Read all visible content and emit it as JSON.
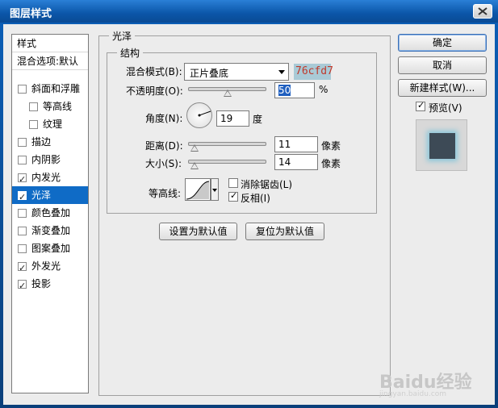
{
  "window": {
    "title": "图层样式"
  },
  "style_list": {
    "header": "样式",
    "blend_default": "混合选项:默认",
    "items": [
      {
        "label": "斜面和浮雕",
        "checked": false
      },
      {
        "label": "等高线",
        "checked": false
      },
      {
        "label": "纹理",
        "checked": false
      },
      {
        "label": "描边",
        "checked": false
      },
      {
        "label": "内阴影",
        "checked": false
      },
      {
        "label": "内发光",
        "checked": true
      },
      {
        "label": "光泽",
        "checked": true
      },
      {
        "label": "颜色叠加",
        "checked": false
      },
      {
        "label": "渐变叠加",
        "checked": false
      },
      {
        "label": "图案叠加",
        "checked": false
      },
      {
        "label": "外发光",
        "checked": true
      },
      {
        "label": "投影",
        "checked": true
      }
    ]
  },
  "satin": {
    "group_title": "光泽",
    "structure_title": "结构",
    "blend_mode_label": "混合模式(B):",
    "blend_mode_value": "正片叠底",
    "color_hex": "76cfd7",
    "opacity_label": "不透明度(O):",
    "opacity_value": "50",
    "opacity_unit": "%",
    "opacity_level": 0.5,
    "angle_label": "角度(N):",
    "angle_value": "19",
    "angle_unit": "度",
    "distance_label": "距离(D):",
    "distance_value": "11",
    "distance_unit": "像素",
    "size_label": "大小(S):",
    "size_value": "14",
    "size_unit": "像素",
    "contour_label": "等高线:",
    "anti_alias_label": "消除锯齿(L)",
    "anti_alias_checked": false,
    "invert_label": "反相(I)",
    "invert_checked": true,
    "set_default_button": "设置为默认值",
    "reset_default_button": "复位为默认值"
  },
  "actions": {
    "ok": "确定",
    "cancel": "取消",
    "new_style": "新建样式(W)...",
    "preview_label": "预览(V)",
    "preview_checked": true
  },
  "watermark": {
    "brand": "Baidu经验",
    "url": "jingyan.baidu.com"
  },
  "colors": {
    "title_bar": "#0b56a8",
    "selection": "#0f6bc6",
    "color_swatch": "#a9cad6",
    "preview_fill": "#3d4a56",
    "preview_glow": "#8cc7da"
  }
}
